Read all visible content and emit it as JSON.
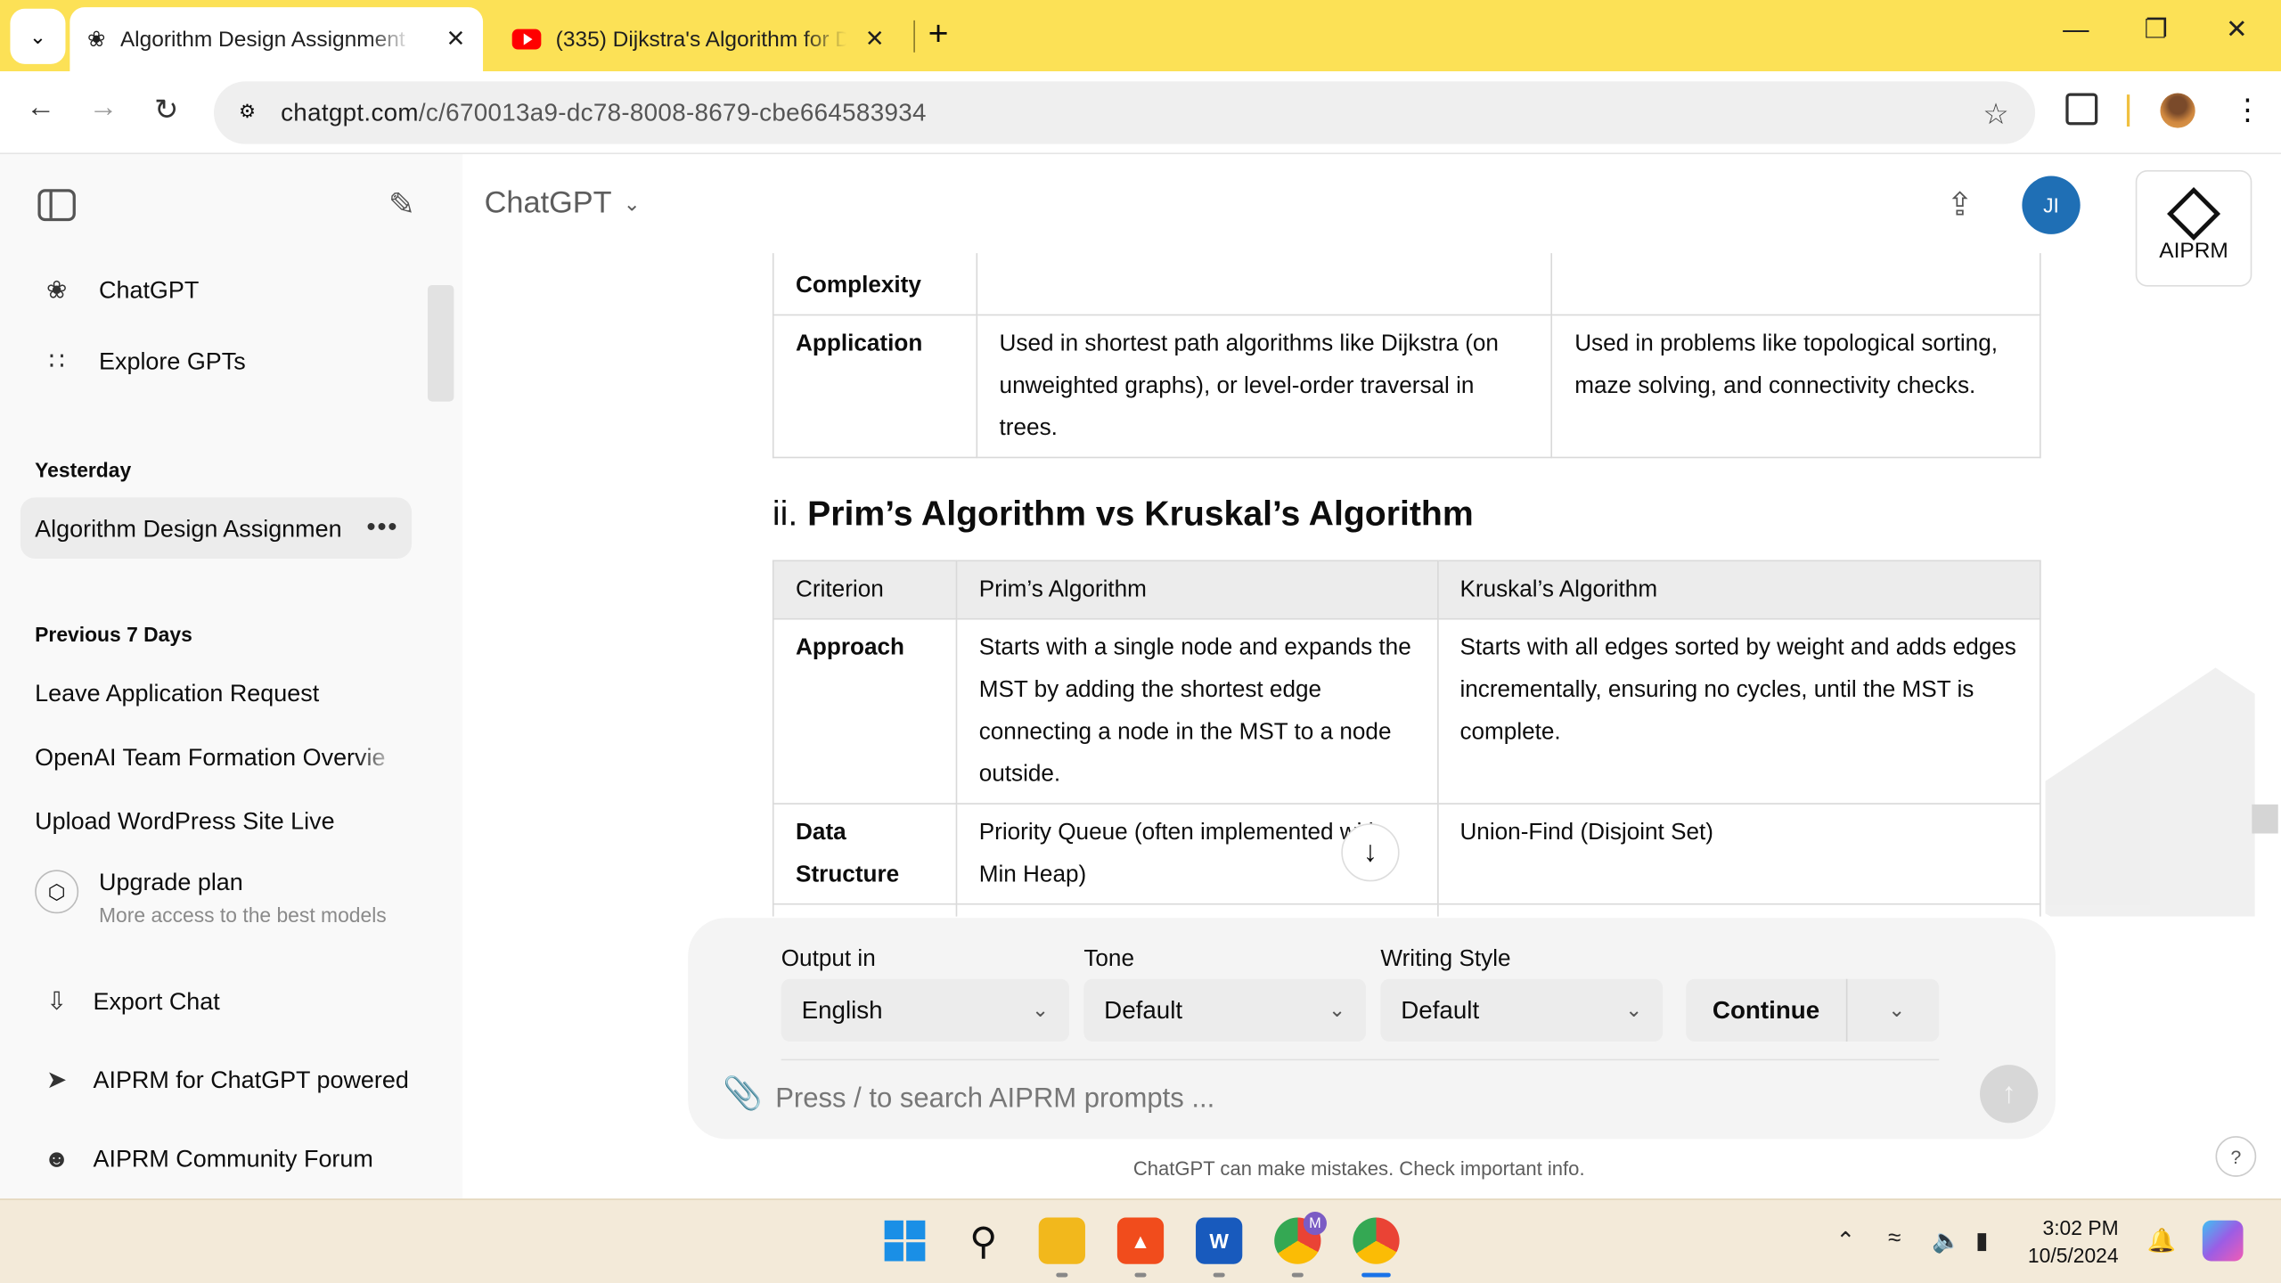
{
  "browser": {
    "tabs": [
      {
        "title": "Algorithm Design Assignment S",
        "active": true
      },
      {
        "title": "(335) Dijkstra's Algorithm for Di",
        "active": false
      }
    ],
    "url_domain": "chatgpt.com",
    "url_path": "/c/670013a9-dc78-8008-8679-cbe664583934"
  },
  "sidebar": {
    "top_items": [
      {
        "label": "ChatGPT",
        "icon": "openai-logo-icon"
      },
      {
        "label": "Explore GPTs",
        "icon": "grid-icon"
      }
    ],
    "sections": [
      {
        "heading": "Yesterday",
        "chats": [
          "Algorithm Design Assignmen"
        ]
      },
      {
        "heading": "Previous 7 Days",
        "chats": [
          "Leave Application Request",
          "OpenAI Team Formation Overvie",
          "Upload WordPress Site Live"
        ]
      }
    ],
    "upgrade": {
      "title": "Upgrade plan",
      "subtitle": "More access to the best models"
    },
    "bottom_items": [
      {
        "label": "Export Chat",
        "icon": "export-icon"
      },
      {
        "label": "AIPRM for ChatGPT powered",
        "icon": "rocket-icon"
      },
      {
        "label": "AIPRM Community Forum",
        "icon": "community-icon"
      }
    ]
  },
  "header": {
    "model_name": "ChatGPT",
    "avatar_initials": "JI",
    "aiprm_label": "AIPRM"
  },
  "table1": {
    "rows": [
      {
        "criterion": "Complexity",
        "col1": "",
        "col2": ""
      },
      {
        "criterion": "Application",
        "col1": "Used in shortest path algorithms like Dijkstra (on unweighted graphs), or level-order traversal in trees.",
        "col2": "Used in problems like topological sorting, maze solving, and connectivity checks."
      }
    ]
  },
  "section2": {
    "number": "ii.",
    "title": "Prim’s Algorithm vs Kruskal’s Algorithm"
  },
  "table2": {
    "headers": [
      "Criterion",
      "Prim’s Algorithm",
      "Kruskal’s Algorithm"
    ],
    "rows": [
      {
        "criterion": "Approach",
        "col1": "Starts with a single node and expands the MST by adding the shortest edge connecting a node in the MST to a node outside.",
        "col2": "Starts with all edges sorted by weight and adds edges incrementally, ensuring no cycles, until the MST is complete."
      },
      {
        "criterion": "Data Structure",
        "col1": "Priority Queue (often implemented with Min Heap)",
        "col2": "Union-Find (Disjoint Set)"
      }
    ]
  },
  "composer": {
    "output_label": "Output in",
    "output_value": "English",
    "tone_label": "Tone",
    "tone_value": "Default",
    "style_label": "Writing Style",
    "style_value": "Default",
    "continue_label": "Continue",
    "placeholder": "Press / to search AIPRM prompts ..."
  },
  "disclaimer": "ChatGPT can make mistakes. Check important info.",
  "help_label": "?",
  "taskbar": {
    "time": "3:02 PM",
    "date": "10/5/2024"
  }
}
